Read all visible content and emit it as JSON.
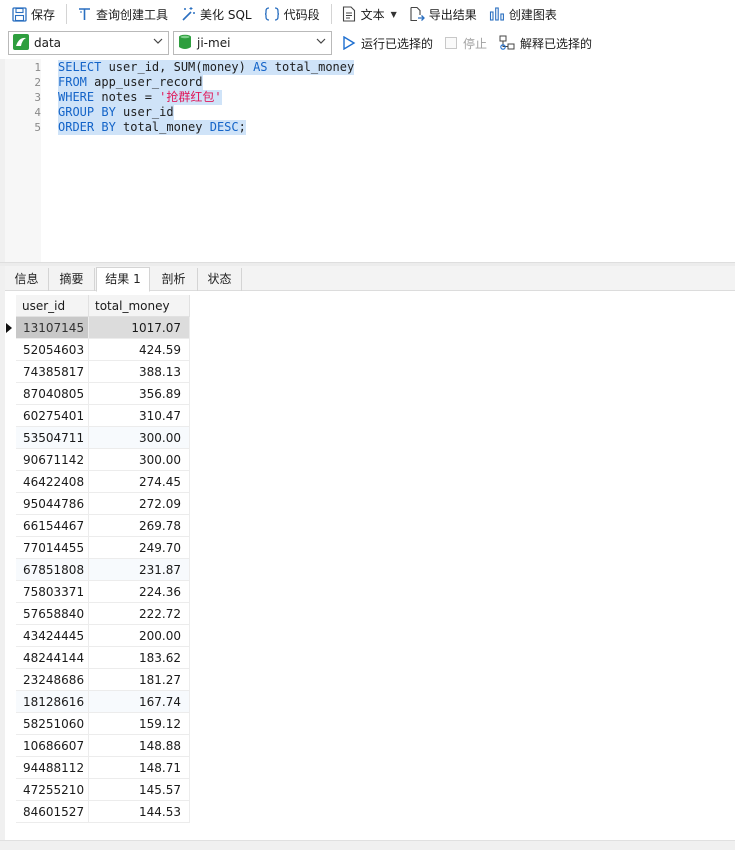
{
  "toolbar": {
    "save": "保存",
    "query_builder": "查询创建工具",
    "beautify_sql": "美化 SQL",
    "code_snippet": "代码段",
    "text": "文本",
    "export_result": "导出结果",
    "create_chart": "创建图表"
  },
  "connection": {
    "connection_name": "data",
    "database_name": "ji-mei",
    "run_selected": "运行已选择的",
    "stop": "停止",
    "explain_selected": "解释已选择的"
  },
  "editor": {
    "line_numbers": [
      "1",
      "2",
      "3",
      "4",
      "5"
    ],
    "lines": [
      {
        "k1": "SELECT",
        "t1": " user_id, SUM(money) ",
        "k2": "AS",
        "t2": " total_money"
      },
      {
        "k1": "FROM",
        "t1": " app_user_record",
        "k2": "",
        "t2": ""
      },
      {
        "k1": "WHERE",
        "t1": " notes = ",
        "s": "'抢群红包'"
      },
      {
        "k1": "GROUP BY",
        "t1": " user_id"
      },
      {
        "k1": "ORDER BY",
        "t1": " total_money ",
        "k2": "DESC",
        "t2": ";"
      }
    ]
  },
  "tabs": [
    "信息",
    "摘要",
    "结果 1",
    "剖析",
    "状态"
  ],
  "active_tab": "结果 1",
  "results": {
    "columns": [
      "user_id",
      "total_money"
    ],
    "rows": [
      [
        "13107145",
        "1017.07"
      ],
      [
        "52054603",
        "424.59"
      ],
      [
        "74385817",
        "388.13"
      ],
      [
        "87040805",
        "356.89"
      ],
      [
        "60275401",
        "310.47"
      ],
      [
        "53504711",
        "300.00"
      ],
      [
        "90671142",
        "300.00"
      ],
      [
        "46422408",
        "274.45"
      ],
      [
        "95044786",
        "272.09"
      ],
      [
        "66154467",
        "269.78"
      ],
      [
        "77014455",
        "249.70"
      ],
      [
        "67851808",
        "231.87"
      ],
      [
        "75803371",
        "224.36"
      ],
      [
        "57658840",
        "222.72"
      ],
      [
        "43424445",
        "200.00"
      ],
      [
        "48244144",
        "183.62"
      ],
      [
        "23248686",
        "181.27"
      ],
      [
        "18128616",
        "167.74"
      ],
      [
        "58251060",
        "159.12"
      ],
      [
        "10686607",
        "148.88"
      ],
      [
        "94488112",
        "148.71"
      ],
      [
        "47255210",
        "145.57"
      ],
      [
        "84601527",
        "144.53"
      ]
    ]
  },
  "colors": {
    "keyword": "#1464c8",
    "string": "#e0185a",
    "selection": "#cfe3f8",
    "accent_blue": "#1e6fd0",
    "db_green": "#2e9e3e"
  }
}
